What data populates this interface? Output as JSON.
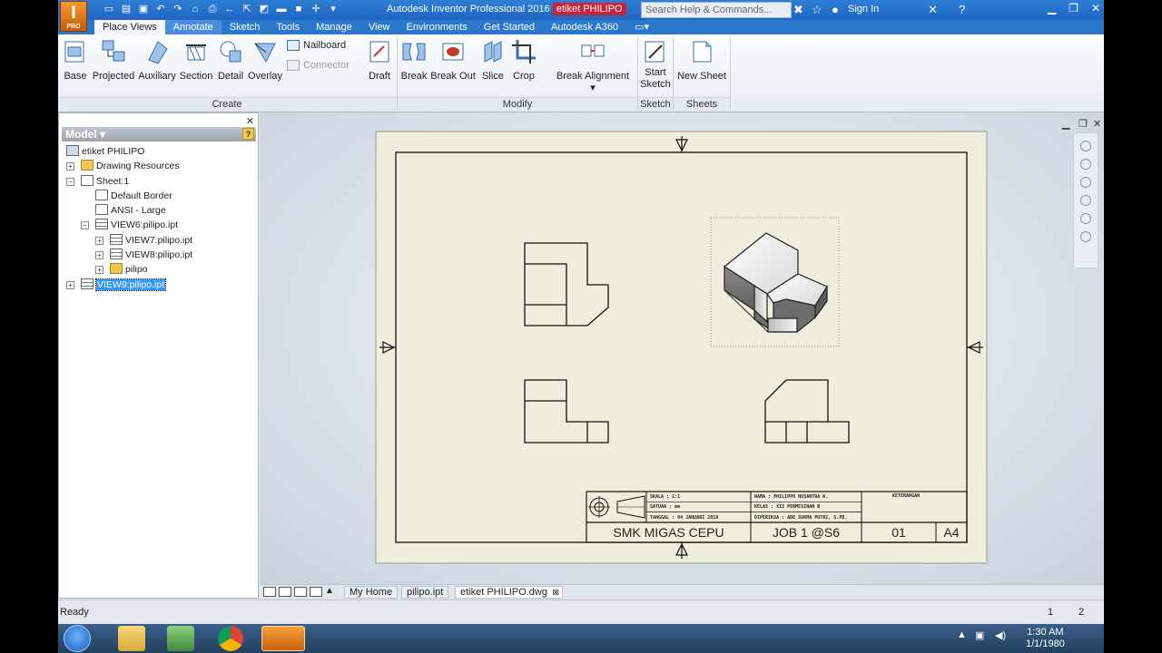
{
  "app": {
    "logo_letter": "I",
    "logo_edition": "PRO",
    "title": "Autodesk Inventor Professional 2016",
    "document_title": "etiket PHILIPO",
    "search_placeholder": "Search Help & Commands...",
    "sign_in": "Sign In"
  },
  "tabs": [
    "Place Views",
    "Annotate",
    "Sketch",
    "Tools",
    "Manage",
    "View",
    "Environments",
    "Get Started",
    "Autodesk A360"
  ],
  "ribbon": {
    "create": {
      "label": "Create",
      "buttons": [
        "Base",
        "Projected",
        "Auxiliary",
        "Section",
        "Detail",
        "Overlay"
      ],
      "small": [
        "Nailboard",
        "Connector"
      ]
    },
    "modify": {
      "label": "Modify",
      "buttons": [
        "Draft",
        "Break",
        "Break Out",
        "Slice",
        "Crop",
        "Break Alignment"
      ]
    },
    "sketch": {
      "label": "Sketch",
      "button_line1": "Start",
      "button_line2": "Sketch"
    },
    "sheets": {
      "label": "Sheets",
      "button": "New Sheet"
    }
  },
  "browser": {
    "title": "Model",
    "help": "?",
    "nodes": [
      {
        "label": "etiket PHILIPO"
      },
      {
        "label": "Drawing Resources"
      },
      {
        "label": "Sheet:1"
      },
      {
        "label": "Default Border"
      },
      {
        "label": "ANSI - Large"
      },
      {
        "label": "VIEW6:pilipo.ipt"
      },
      {
        "label": "VIEW7:pilipo.ipt"
      },
      {
        "label": "VIEW8:pilipo.ipt"
      },
      {
        "label": "pilipo"
      },
      {
        "label": "VIEW9:pilipo.ipt"
      }
    ]
  },
  "titleblock": {
    "school": "SMK MIGAS CEPU",
    "job": "JOB 1 @S6",
    "number": "01",
    "size": "A4",
    "left_rows": [
      {
        "k": "SKALA",
        "v": ": 1:1"
      },
      {
        "k": "SATUAN",
        "v": ": mm"
      },
      {
        "k": "TANGGAL",
        "v": ": 04 JANUARI 2018"
      }
    ],
    "mid_rows": [
      {
        "k": "NAMA",
        "v": ": PHILIPPO NUSANTRA K."
      },
      {
        "k": "KELAS",
        "v": ": XII PERMESINAN B"
      },
      {
        "k": "DIPERIKSA",
        "v": ": ADE SUKMA PUTRI, S.PD."
      }
    ],
    "remarks": "KETERANGAN"
  },
  "doc_tabs": [
    "My Home",
    "pilipo.ipt",
    "etiket PHILIPO.dwg"
  ],
  "status": {
    "text": "Ready",
    "n1": "1",
    "n2": "2"
  },
  "taskbar": {
    "time": "1:30 AM",
    "date": "1/1/1980"
  }
}
